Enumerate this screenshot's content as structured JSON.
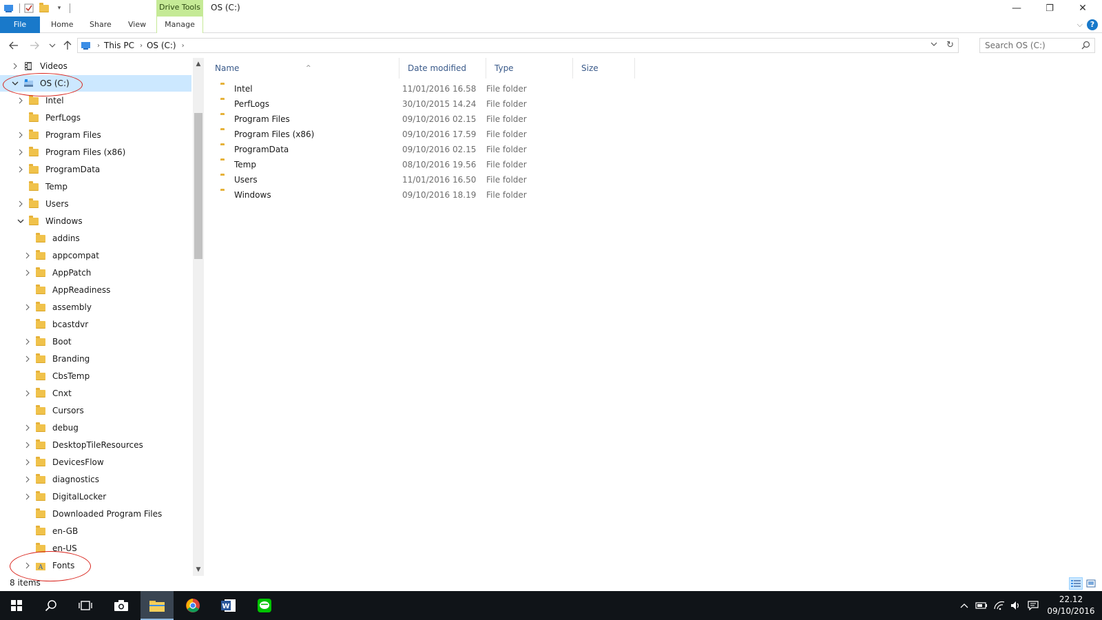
{
  "window": {
    "title": "OS (C:)",
    "context_tab": "Drive Tools",
    "minimize_glyph": "—",
    "restore_glyph": "❐",
    "close_glyph": "✕"
  },
  "ribbon": {
    "tabs": [
      "File",
      "Home",
      "Share",
      "View",
      "Manage"
    ],
    "help_glyph": "?"
  },
  "address": {
    "crumbs": [
      "This PC",
      "OS (C:)"
    ]
  },
  "search": {
    "placeholder": "Search OS (C:)"
  },
  "nav_tree": [
    {
      "label": "Videos",
      "level": 0,
      "expander": ">",
      "icon": "videos-icon"
    },
    {
      "label": "OS (C:)",
      "level": 0,
      "expander": "v",
      "icon": "drive-icon",
      "selected": true
    },
    {
      "label": "Intel",
      "level": 1,
      "expander": ">"
    },
    {
      "label": "PerfLogs",
      "level": 1,
      "expander": ""
    },
    {
      "label": "Program Files",
      "level": 1,
      "expander": ">"
    },
    {
      "label": "Program Files (x86)",
      "level": 1,
      "expander": ">"
    },
    {
      "label": "ProgramData",
      "level": 1,
      "expander": ">"
    },
    {
      "label": "Temp",
      "level": 1,
      "expander": ""
    },
    {
      "label": "Users",
      "level": 1,
      "expander": ">"
    },
    {
      "label": "Windows",
      "level": 1,
      "expander": "v"
    },
    {
      "label": "addins",
      "level": 2,
      "expander": ""
    },
    {
      "label": "appcompat",
      "level": 2,
      "expander": ">"
    },
    {
      "label": "AppPatch",
      "level": 2,
      "expander": ">"
    },
    {
      "label": "AppReadiness",
      "level": 2,
      "expander": ""
    },
    {
      "label": "assembly",
      "level": 2,
      "expander": ">"
    },
    {
      "label": "bcastdvr",
      "level": 2,
      "expander": ""
    },
    {
      "label": "Boot",
      "level": 2,
      "expander": ">"
    },
    {
      "label": "Branding",
      "level": 2,
      "expander": ">"
    },
    {
      "label": "CbsTemp",
      "level": 2,
      "expander": ""
    },
    {
      "label": "Cnxt",
      "level": 2,
      "expander": ">"
    },
    {
      "label": "Cursors",
      "level": 2,
      "expander": ""
    },
    {
      "label": "debug",
      "level": 2,
      "expander": ">"
    },
    {
      "label": "DesktopTileResources",
      "level": 2,
      "expander": ">"
    },
    {
      "label": "DevicesFlow",
      "level": 2,
      "expander": ">"
    },
    {
      "label": "diagnostics",
      "level": 2,
      "expander": ">"
    },
    {
      "label": "DigitalLocker",
      "level": 2,
      "expander": ">"
    },
    {
      "label": "Downloaded Program Files",
      "level": 2,
      "expander": ""
    },
    {
      "label": "en-GB",
      "level": 2,
      "expander": ""
    },
    {
      "label": "en-US",
      "level": 2,
      "expander": ""
    },
    {
      "label": "Fonts",
      "level": 2,
      "expander": ">",
      "icon": "fonts-folder-icon"
    }
  ],
  "columns": [
    "Name",
    "Date modified",
    "Type",
    "Size"
  ],
  "files": [
    {
      "name": "Intel",
      "date": "11/01/2016 16.58",
      "type": "File folder"
    },
    {
      "name": "PerfLogs",
      "date": "30/10/2015 14.24",
      "type": "File folder"
    },
    {
      "name": "Program Files",
      "date": "09/10/2016 02.15",
      "type": "File folder"
    },
    {
      "name": "Program Files (x86)",
      "date": "09/10/2016 17.59",
      "type": "File folder"
    },
    {
      "name": "ProgramData",
      "date": "09/10/2016 02.15",
      "type": "File folder"
    },
    {
      "name": "Temp",
      "date": "08/10/2016 19.56",
      "type": "File folder"
    },
    {
      "name": "Users",
      "date": "11/01/2016 16.50",
      "type": "File folder"
    },
    {
      "name": "Windows",
      "date": "09/10/2016 18.19",
      "type": "File folder"
    }
  ],
  "status": {
    "item_count": "8 items"
  },
  "taskbar": {
    "apps": [
      "start-icon",
      "search-icon",
      "task-view-icon",
      "camera-icon",
      "file-explorer-icon",
      "chrome-icon",
      "word-icon",
      "line-icon"
    ],
    "time": "22.12",
    "date": "09/10/2016"
  },
  "colors": {
    "accent": "#1979ca",
    "context_green": "#c5ea96",
    "selection": "#cce8ff",
    "folder": "#f0c24b",
    "annotation": "#d9241c",
    "taskbar": "#101418"
  }
}
